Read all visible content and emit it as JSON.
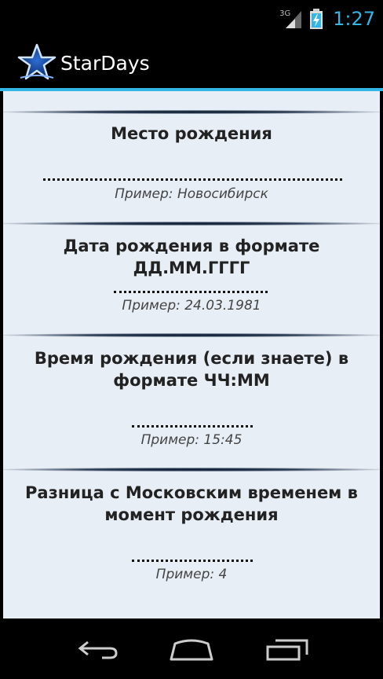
{
  "status_bar": {
    "network": "3G",
    "time": "1:27"
  },
  "action_bar": {
    "title": "StarDays",
    "icon": "star-icon"
  },
  "fields": [
    {
      "label": "Место рождения",
      "example": "Пример: Новосибирск"
    },
    {
      "label": "Дата рождения в формате ДД.ММ.ГГГГ",
      "example": "Пример: 24.03.1981"
    },
    {
      "label": "Время рождения (если знаете) в формате ЧЧ:ММ",
      "example": "Пример: 15:45"
    },
    {
      "label": "Разница с Московским временем в момент рождения",
      "example": "Пример: 4"
    }
  ],
  "nav_bar": {
    "back_icon": "back-icon",
    "home_icon": "home-icon",
    "recents_icon": "recent-apps-icon"
  },
  "colors": {
    "accent": "#33b5e5",
    "content_bg": "#e8eef6"
  }
}
